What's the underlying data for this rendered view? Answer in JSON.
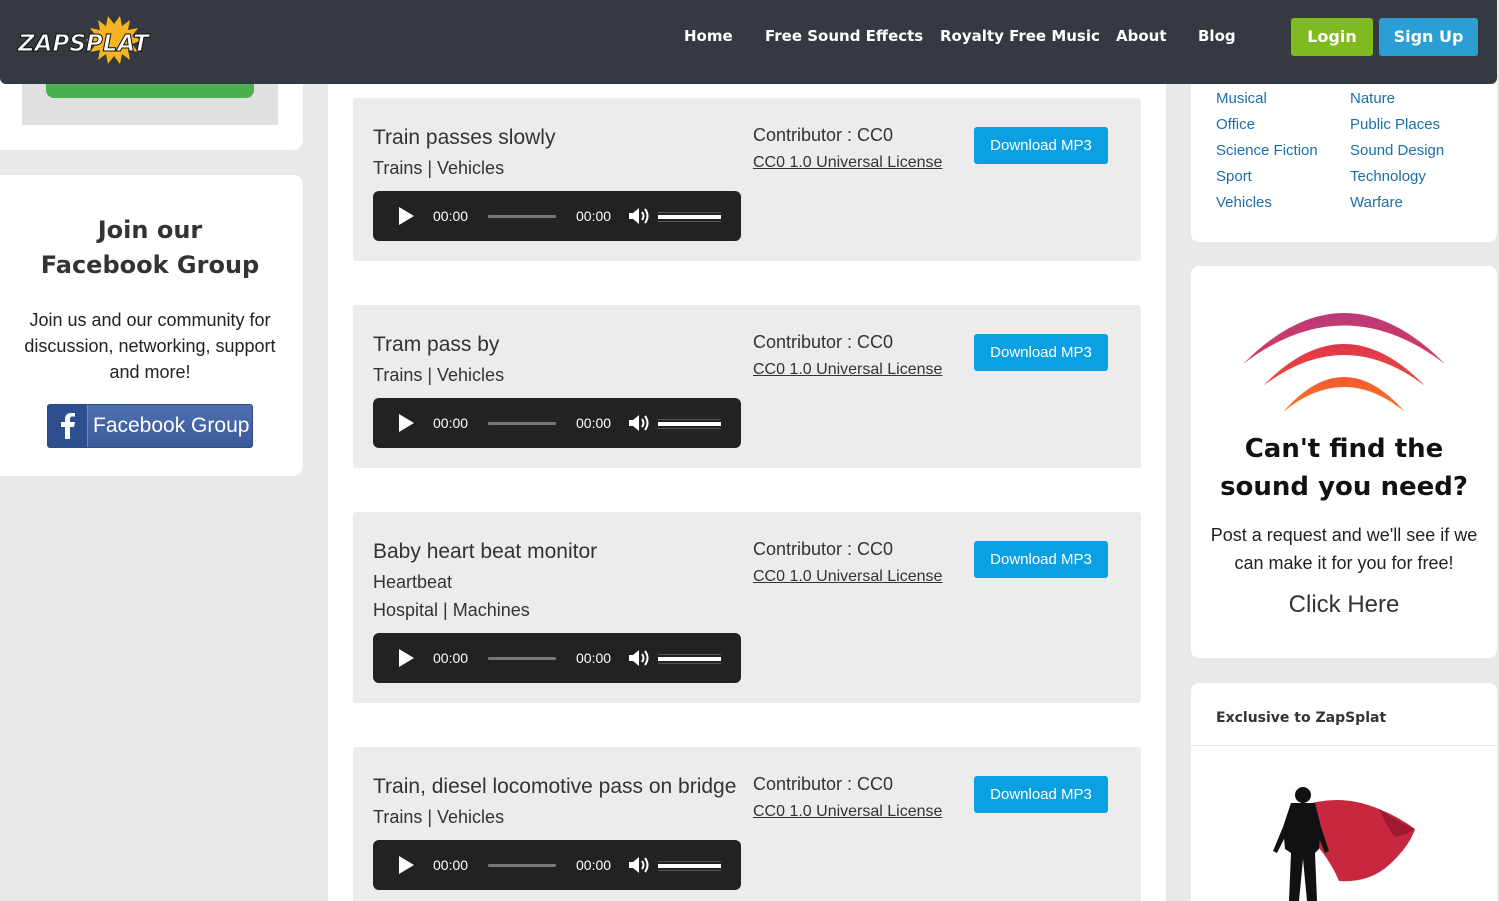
{
  "header": {
    "logo_text": "ZAPSPLAT",
    "nav": [
      "Home",
      "Free Sound Effects",
      "Royalty Free Music",
      "About",
      "Blog"
    ],
    "login_label": "Login",
    "signup_label": "Sign Up"
  },
  "facebook": {
    "title_line1": "Join our",
    "title_line2": "Facebook Group",
    "text": "Join us and our community for discussion, networking, support and more!",
    "button_label": "Facebook Group"
  },
  "sounds": [
    {
      "title": "Train passes slowly",
      "lines": [
        "Trains | Vehicles"
      ],
      "contributor": "Contributor : CC0",
      "license": "CC0 1.0 Universal License",
      "download_label": "Download MP3",
      "current_time": "00:00",
      "duration": "00:00"
    },
    {
      "title": "Tram pass by",
      "lines": [
        "Trains | Vehicles"
      ],
      "contributor": "Contributor : CC0",
      "license": "CC0 1.0 Universal License",
      "download_label": "Download MP3",
      "current_time": "00:00",
      "duration": "00:00"
    },
    {
      "title": "Baby heart beat monitor",
      "lines": [
        "Heartbeat",
        "Hospital | Machines"
      ],
      "contributor": "Contributor : CC0",
      "license": "CC0 1.0 Universal License",
      "download_label": "Download MP3",
      "current_time": "00:00",
      "duration": "00:00"
    },
    {
      "title": "Train, diesel locomotive pass on bridge",
      "lines": [
        "Trains | Vehicles"
      ],
      "contributor": "Contributor : CC0",
      "license": "CC0 1.0 Universal License",
      "download_label": "Download MP3",
      "current_time": "00:00",
      "duration": "00:00"
    }
  ],
  "categories": {
    "col1": [
      "Musical",
      "Office",
      "Science Fiction",
      "Sport",
      "Vehicles"
    ],
    "col2": [
      "Nature",
      "Public Places",
      "Sound Design",
      "Technology",
      "Warfare"
    ]
  },
  "request": {
    "title_line1": "Can't find the",
    "title_line2": "sound you need?",
    "text": "Post a request and we'll see if we can make it for you for free!",
    "link": "Click Here"
  },
  "exclusive": {
    "title": "Exclusive to ZapSplat"
  },
  "colors": {
    "header_bg": "#343a40",
    "login_green": "#7fba1f",
    "signup_blue": "#2b9fd3",
    "download_blue": "#0aa0e2",
    "link_blue": "#1b6fa8"
  }
}
